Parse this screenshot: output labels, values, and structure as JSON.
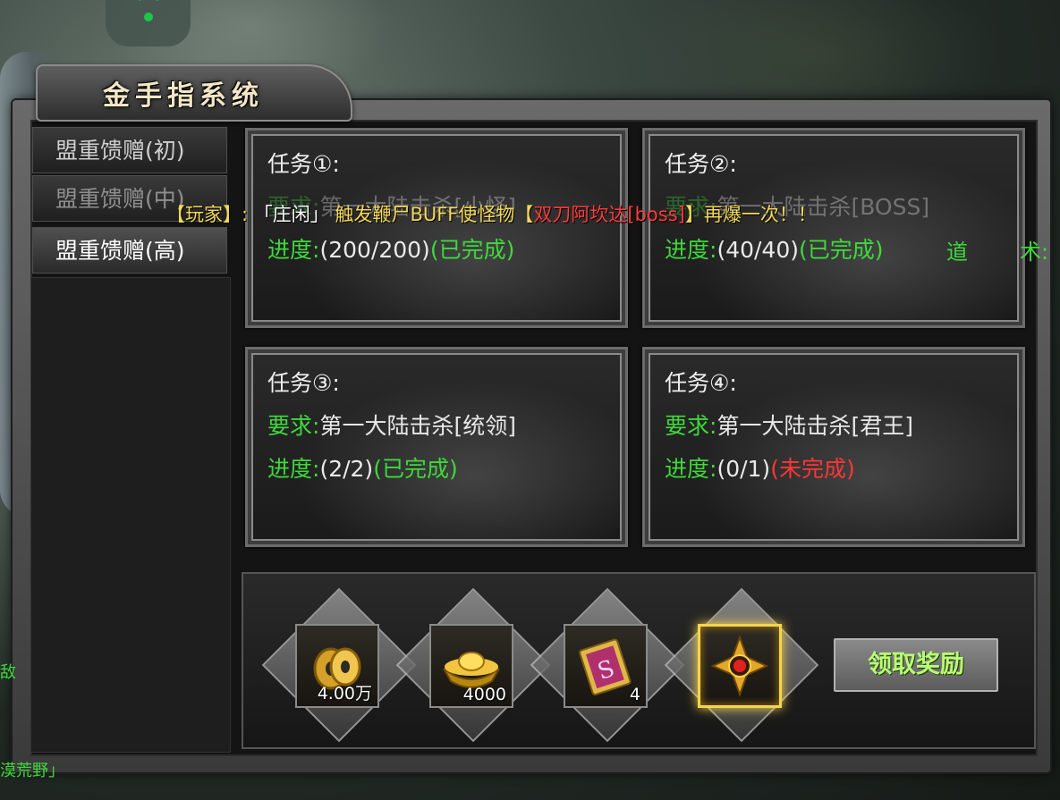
{
  "window": {
    "title": "金手指系统"
  },
  "sidebar": {
    "tabs": [
      {
        "label": "盟重馈赠(初)"
      },
      {
        "label": "盟重馈赠(中)"
      },
      {
        "label": "盟重馈赠(高)"
      }
    ]
  },
  "tasks": [
    {
      "header": "任务①:",
      "req_label": "要求:",
      "req_value": "第一大陆击杀[小怪]",
      "prog_label": "进度:",
      "prog_value": "(200/200)",
      "status": "(已完成)"
    },
    {
      "header": "任务②:",
      "req_label": "要求:",
      "req_value": "第一大陆击杀[BOSS]",
      "prog_label": "进度:",
      "prog_value": "(40/40)",
      "status": "(已完成)"
    },
    {
      "header": "任务③:",
      "req_label": "要求:",
      "req_value": "第一大陆击杀[统领]",
      "prog_label": "进度:",
      "prog_value": "(2/2)",
      "status": "(已完成)"
    },
    {
      "header": "任务④:",
      "req_label": "要求:",
      "req_value": "第一大陆击杀[君王]",
      "prog_label": "进度:",
      "prog_value": "(0/1)",
      "status": "(未完成)"
    }
  ],
  "broadcast": {
    "prefix": "【玩家】:",
    "player": "「庄闲」",
    "action": "触发鞭尸BUFF使怪物【",
    "boss": "双刀阿坎达[boss]",
    "suffix": "】再爆一次！！"
  },
  "side_text": {
    "a": "道",
    "b": "术:"
  },
  "rewards": [
    {
      "icon": "gold-coins-icon",
      "qty": "4.00万"
    },
    {
      "icon": "gold-ingot-icon",
      "qty": "4000"
    },
    {
      "icon": "scroll-card-icon",
      "qty": "4"
    },
    {
      "icon": "jewel-emblem-icon",
      "qty": ""
    }
  ],
  "claim_button": {
    "label": "领取奖励"
  },
  "edge_text": {
    "left1": "敌",
    "left2": "漠荒野」"
  },
  "colors": {
    "done": "#3fd83c",
    "not_done": "#ff3636",
    "label_green": "#3fd83c",
    "broadcast_yellow": "#f3d85a"
  }
}
